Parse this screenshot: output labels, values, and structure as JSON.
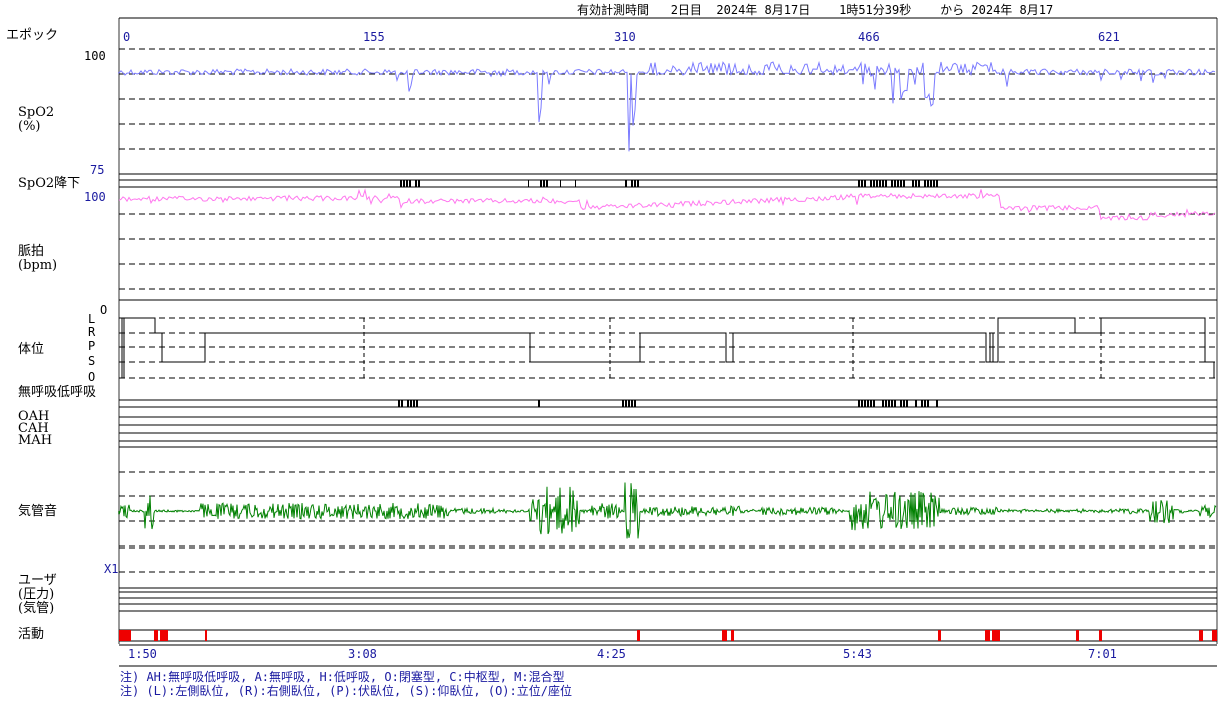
{
  "header": {
    "label": "有効計測時間",
    "day": "2日目",
    "date_start": "2024年 8月17日",
    "duration": "1時51分39秒",
    "from_label": "から",
    "date_end": "2024年 8月17"
  },
  "epoch": {
    "label": "エポック",
    "ticks": [
      "0",
      "155",
      "310",
      "466",
      "621"
    ]
  },
  "spo2": {
    "label": "SpO2",
    "unit": "(%)",
    "top_value": "100",
    "bottom_value": "75",
    "line_color": "#7b7bff"
  },
  "spo2_drop": {
    "label": "SpO2降下"
  },
  "pulse": {
    "label": "脈拍",
    "unit": "(bpm)",
    "top_value": "100",
    "line_color": "#ff77ee"
  },
  "position": {
    "label": "体位",
    "levels": [
      "O",
      "L",
      "R",
      "P",
      "S",
      "O"
    ]
  },
  "apnea": {
    "label": "無呼吸低呼吸",
    "rows": [
      "OAH",
      "CAH",
      "MAH"
    ]
  },
  "trachea": {
    "label": "気管音",
    "line_color": "#008000"
  },
  "user": {
    "label": "ユーザ",
    "sub1": "(圧力)",
    "sub2": "(気管)",
    "scale": "X1"
  },
  "activity": {
    "label": "活動",
    "mark_color": "#ee0000"
  },
  "time_axis": {
    "ticks": [
      "1:50",
      "3:08",
      "4:25",
      "5:43",
      "7:01"
    ]
  },
  "notes": [
    "注) AH:無呼吸低呼吸, A:無呼吸, H:低呼吸, O:閉塞型, C:中枢型, M:混合型",
    "注) (L):左側臥位, (R):右側臥位, (P):伏臥位, (S):仰臥位, (O):立位/座位"
  ]
}
